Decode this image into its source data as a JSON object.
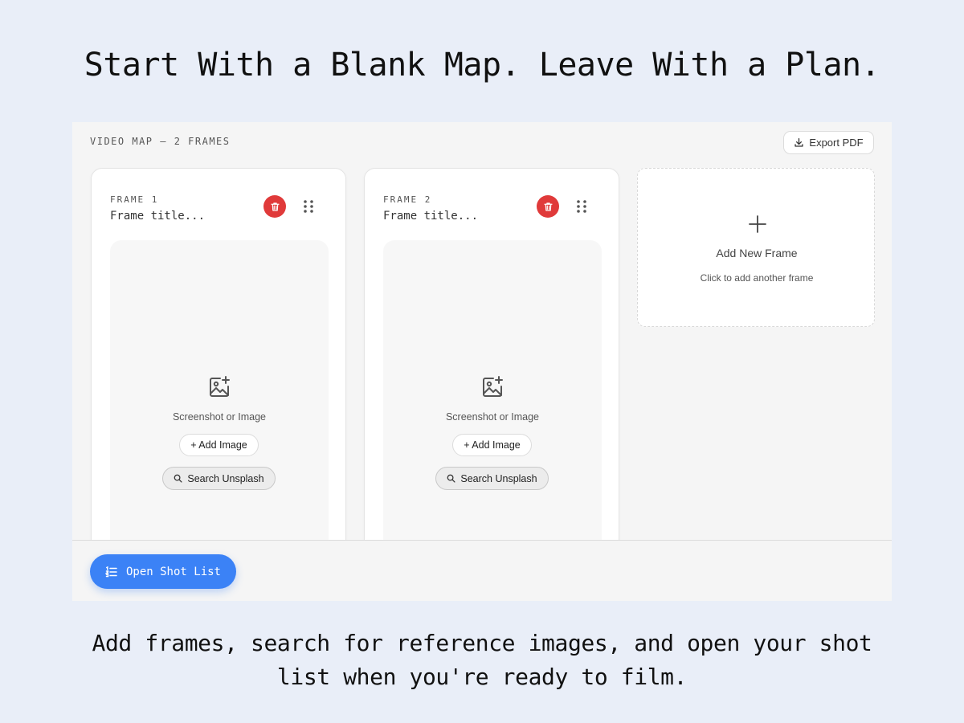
{
  "headline": "Start With a Blank Map. Leave With a Plan.",
  "caption": "Add frames, search for reference images, and open your shot list when you're ready to film.",
  "panel": {
    "header": "VIDEO MAP — 2 FRAMES",
    "export_label": "Export PDF",
    "export_icon": "download-icon"
  },
  "frames": [
    {
      "label": "FRAME 1",
      "title_placeholder": "Frame title...",
      "image_prompt": "Screenshot or Image",
      "add_image_label": "+ Add Image",
      "search_label": "Search Unsplash"
    },
    {
      "label": "FRAME 2",
      "title_placeholder": "Frame title...",
      "image_prompt": "Screenshot or Image",
      "add_image_label": "+ Add Image",
      "search_label": "Search Unsplash"
    }
  ],
  "add_frame": {
    "title": "Add New Frame",
    "subtitle": "Click to add another frame"
  },
  "bottom": {
    "shot_list_label": "Open Shot List"
  },
  "colors": {
    "page_bg": "#e9eef8",
    "accent_blue": "#3b82f6",
    "delete_red": "#e03a3a"
  }
}
